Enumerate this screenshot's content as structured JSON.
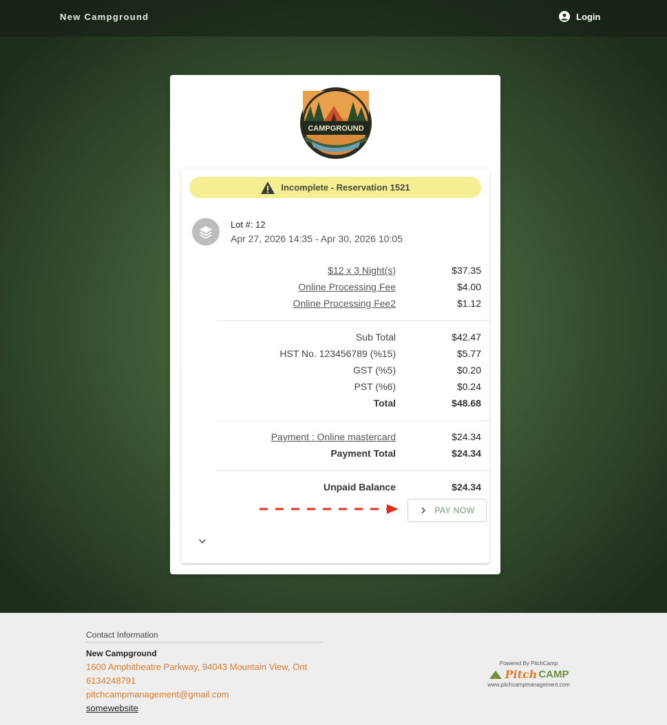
{
  "header": {
    "brand": "New Campground",
    "login_label": "Login"
  },
  "logo": {
    "text": "CAMPGROUND"
  },
  "status": {
    "text": "Incomplete - Reservation 1521",
    "icon": "warning-icon",
    "color": "#f6ee93"
  },
  "reservation": {
    "lot": "Lot #: 12",
    "dates": "Apr 27, 2026 14:35 - Apr 30, 2026 10:05"
  },
  "charges": [
    {
      "label": "$12 x 3 Night(s)",
      "value": "$37.35"
    },
    {
      "label": "Online Processing Fee",
      "value": "$4.00"
    },
    {
      "label": "Online Processing Fee2",
      "value": "$1.12"
    }
  ],
  "taxes": [
    {
      "label": "Sub Total",
      "value": "$42.47"
    },
    {
      "label": "HST No. 123456789 (%15)",
      "value": "$5.77"
    },
    {
      "label": "GST (%5)",
      "value": "$0.20"
    },
    {
      "label": "PST (%6)",
      "value": "$0.24"
    },
    {
      "label": "Total",
      "value": "$48.68"
    }
  ],
  "payments": [
    {
      "label": "Payment : Online mastercard",
      "value": "$24.34"
    },
    {
      "label": "Payment Total",
      "value": "$24.34"
    }
  ],
  "balance": {
    "label": "Unpaid Balance",
    "value": "$24.34"
  },
  "pay_button": {
    "label": "PAY NOW"
  },
  "footer": {
    "title": "Contact Information",
    "name": "New Campground",
    "address": "1600 Amphitheatre Parkway, 94043 Mountain View, Ont",
    "phone": "6134248791",
    "email": "pitchcampmanagement@gmail.com",
    "website": "somewebsite"
  },
  "powered": {
    "line1": "Powered By PitchCamp",
    "pitch": "Pitch",
    "camp": "CAMP",
    "url": "www.pitchcampmanagement.com"
  },
  "colors": {
    "accent_orange": "#e07b2a",
    "accent_green": "#6b8f3a",
    "arrow_red": "#d9341a"
  }
}
